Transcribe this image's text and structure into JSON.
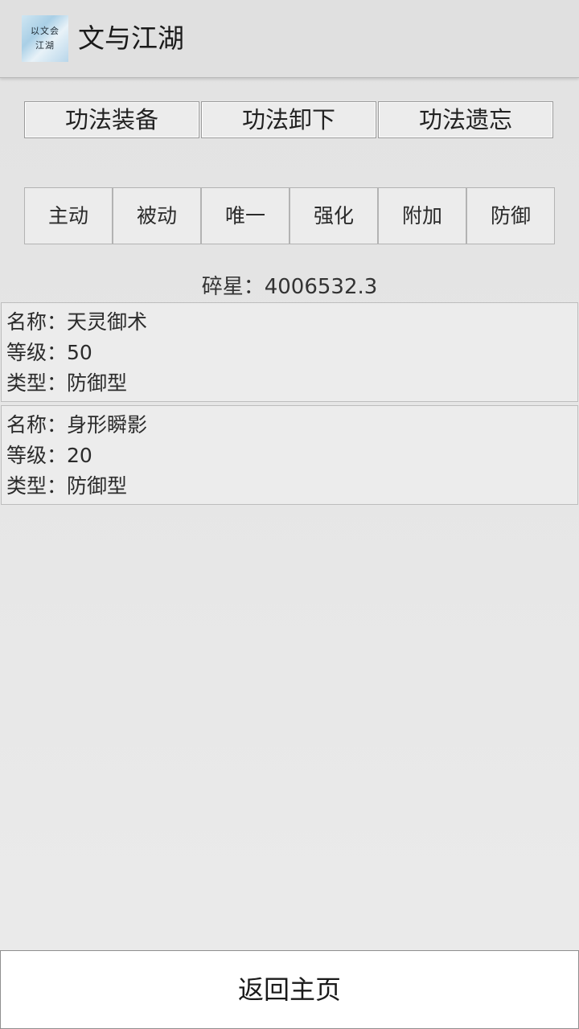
{
  "app_bar": {
    "title": "文与江湖",
    "icon_text_line1": "以文会",
    "icon_text_line2": "江湖"
  },
  "actions": [
    {
      "label": "功法装备"
    },
    {
      "label": "功法卸下"
    },
    {
      "label": "功法遗忘"
    }
  ],
  "categories": [
    {
      "label": "主动"
    },
    {
      "label": "被动"
    },
    {
      "label": "唯一"
    },
    {
      "label": "强化"
    },
    {
      "label": "附加"
    },
    {
      "label": "防御"
    }
  ],
  "currency_text": "碎星：4006532.3",
  "skills": [
    {
      "name_line": "名称：天灵御术",
      "level_line": "等级：50",
      "type_line": "类型：防御型"
    },
    {
      "name_line": "名称：身形瞬影",
      "level_line": "等级：20",
      "type_line": "类型：防御型"
    }
  ],
  "bottom_button": {
    "label": "返回主页"
  }
}
